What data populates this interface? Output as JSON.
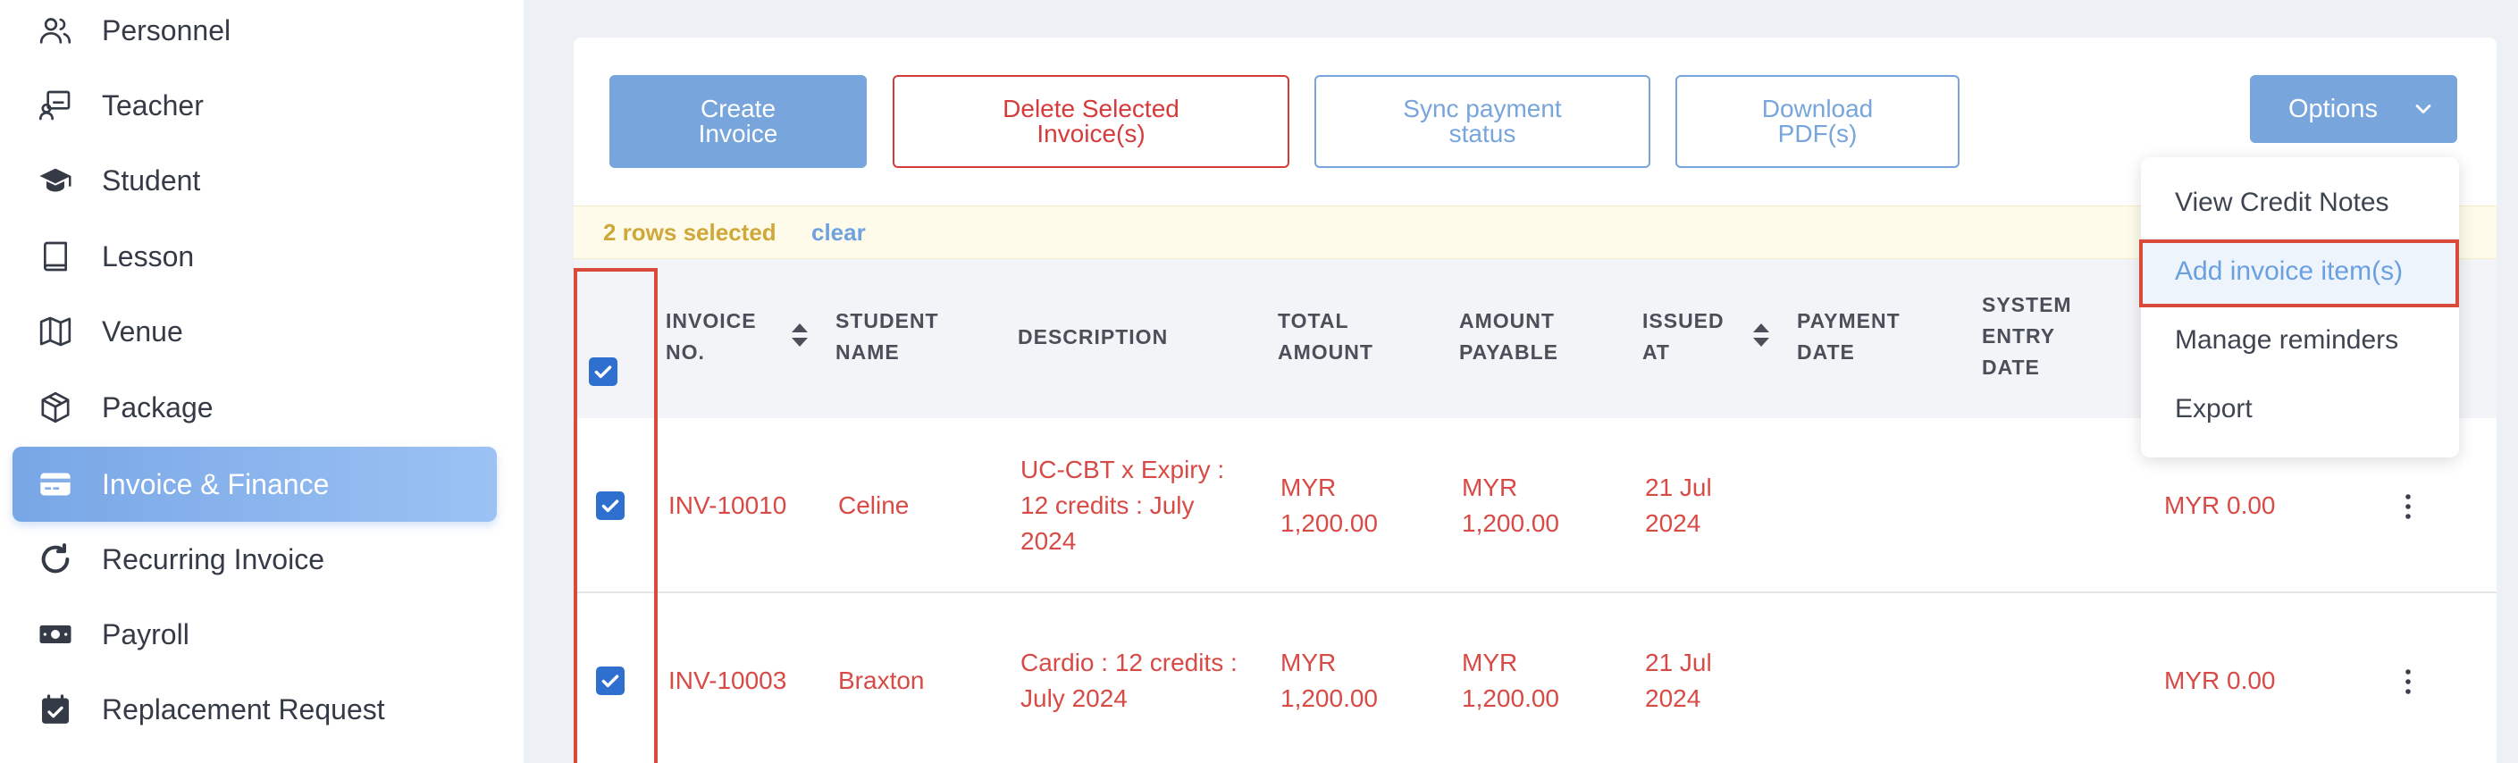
{
  "sidebar": {
    "items": [
      {
        "label": "Personnel",
        "icon": "users-icon"
      },
      {
        "label": "Teacher",
        "icon": "teacher-icon"
      },
      {
        "label": "Student",
        "icon": "graduation-cap-icon"
      },
      {
        "label": "Lesson",
        "icon": "book-icon"
      },
      {
        "label": "Venue",
        "icon": "map-icon"
      },
      {
        "label": "Package",
        "icon": "package-icon"
      },
      {
        "label": "Invoice & Finance",
        "icon": "credit-card-icon",
        "active": true
      },
      {
        "label": "Recurring Invoice",
        "icon": "refresh-icon"
      },
      {
        "label": "Payroll",
        "icon": "money-icon"
      },
      {
        "label": "Replacement Request",
        "icon": "calendar-check-icon"
      }
    ]
  },
  "toolbar": {
    "create_label": "Create Invoice",
    "delete_label": "Delete Selected Invoice(s)",
    "sync_label": "Sync payment status",
    "pdf_label": "Download PDF(s)",
    "options_label": "Options"
  },
  "options_menu": {
    "items": [
      "View Credit Notes",
      "Add invoice item(s)",
      "Manage reminders",
      "Export"
    ],
    "highlighted": "Add invoice item(s)"
  },
  "selection": {
    "count_text": "2 rows selected",
    "clear_label": "clear"
  },
  "table": {
    "headers": {
      "invoice_no": "INVOICE NO.",
      "student_name": "STUDENT NAME",
      "description": "DESCRIPTION",
      "total_amount": "TOTAL AMOUNT",
      "amount_payable": "AMOUNT PAYABLE",
      "issued_at": "ISSUED AT",
      "payment_date": "PAYMENT DATE",
      "system_entry_date": "SYSTEM ENTRY DATE"
    },
    "rows": [
      {
        "invoice_no": "INV-10010",
        "student_name": "Celine",
        "description": "UC-CBT x Expiry : 12 credits : July 2024",
        "total_amount": "MYR 1,200.00",
        "amount_payable": "MYR 1,200.00",
        "issued_at": "21 Jul 2024",
        "payment_date": "",
        "system_entry_date": "",
        "balance": "MYR 0.00",
        "selected": true
      },
      {
        "invoice_no": "INV-10003",
        "student_name": "Braxton",
        "description": "Cardio : 12 credits : July 2024",
        "total_amount": "MYR 1,200.00",
        "amount_payable": "MYR 1,200.00",
        "issued_at": "21 Jul 2024",
        "payment_date": "",
        "system_entry_date": "",
        "balance": "MYR 0.00",
        "selected": true
      }
    ]
  },
  "colors": {
    "primary": "#77a5dc",
    "danger": "#d63b3b",
    "row_text": "#d84a45",
    "highlight_outline": "#d94a3a",
    "selection_text": "#cfa83a"
  }
}
